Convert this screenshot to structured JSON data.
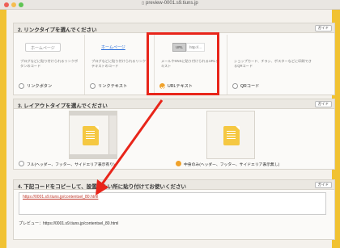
{
  "window": {
    "url": "preview-0001.s9.tiuns.jp"
  },
  "section2": {
    "title": "2. リンクタイプを選んでください",
    "guide": "ガイド",
    "options": [
      {
        "demo": "ホームページ",
        "desc": "ブログなどに貼り付けられるリンクボタンのコード",
        "label": "リンクボタン",
        "selected": false
      },
      {
        "demo": "ホームページ",
        "desc": "ブログなどに貼り付けられるリンクテキストのコード",
        "label": "リンクテキスト",
        "selected": false
      },
      {
        "demo_a": "URL",
        "demo_b": "http://...",
        "desc": "メールやSNSに貼り付けられるURLテキスト",
        "label": "URLテキスト",
        "selected": true
      },
      {
        "desc": "ショップカード、チラシ、ポスターなどに印刷できるQRコード",
        "label": "QRコード",
        "selected": false
      }
    ]
  },
  "section3": {
    "title": "3. レイアウトタイプを選んでください",
    "guide": "ガイド",
    "options": [
      {
        "label": "フル(ヘッダー、フッター、サイドエリア表示有り)",
        "selected": false
      },
      {
        "label": "中身のみ(ヘッダー、フッター、サイドエリア表示無し)",
        "selected": true
      }
    ]
  },
  "section4": {
    "title": "4. 下記コードをコピーして、設置したい所に貼り付けてお使いください",
    "guide": "ガイド",
    "code": "https://0001.s9.tiuns.jp/contentsel_80.html",
    "preview_label": "プレビュー：https://0001.s9.tiuns.jp/contentsel_80.html"
  },
  "colors": {
    "accent": "#f0a22b",
    "annotation": "#e8251a",
    "gold": "#f1c232"
  }
}
